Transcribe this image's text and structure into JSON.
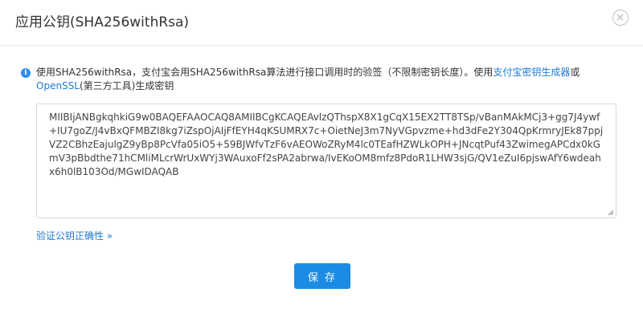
{
  "dialog": {
    "title": "应用公钥(SHA256withRsa)",
    "close_icon": "close-circle-icon"
  },
  "notice": {
    "icon": "info-icon",
    "text_before": "使用SHA256withRsa，支付宝会用SHA256withRsa算法进行接口调用时的验签（不限制密钥长度）。使用",
    "link1": "支付宝密钥生成器",
    "text_or": "或",
    "link2": "OpenSSL",
    "text_after": "(第三方工具)生成密钥"
  },
  "public_key": {
    "value": "MIIBIjANBgkqhkiG9w0BAQEFAAOCAQ8AMIIBCgKCAQEAvlzQThspX8X1gCqX15EX2TT8TSp/vBanMAkMCj3+gg7J4ywf+IU7goZ/J4vBxQFMBZI8kg7iZspOjAIjFfEYH4qKSUMRX7c+OietNeJ3m7NyVGpvzme+hd3dFe2Y304QpKrmryJEk87ppjVZ2CBhzEajulgZ9yBp8PcVfa05iO5+59BJWfvTzF6vAEOWoZRyM4lc0TEafHZWLkOPH+JNcqtPuf43ZwimegAPCdx0kGmV3pBbdthe71hCMliMLcrWrUxWYj3WAuxoFf2sPA2abrwa/IvEKoOM8mfz8PdoR1LHW3sjG/QV1eZuI6pjswAfY6wdeahx6h0lB103Od/MGwIDAQAB"
  },
  "verify_link": "验证公钥正确性 »",
  "save_button": "保 存",
  "colors": {
    "link": "#1f7bd0",
    "primary": "#1b8ce3",
    "info": "#2d8cf0"
  }
}
